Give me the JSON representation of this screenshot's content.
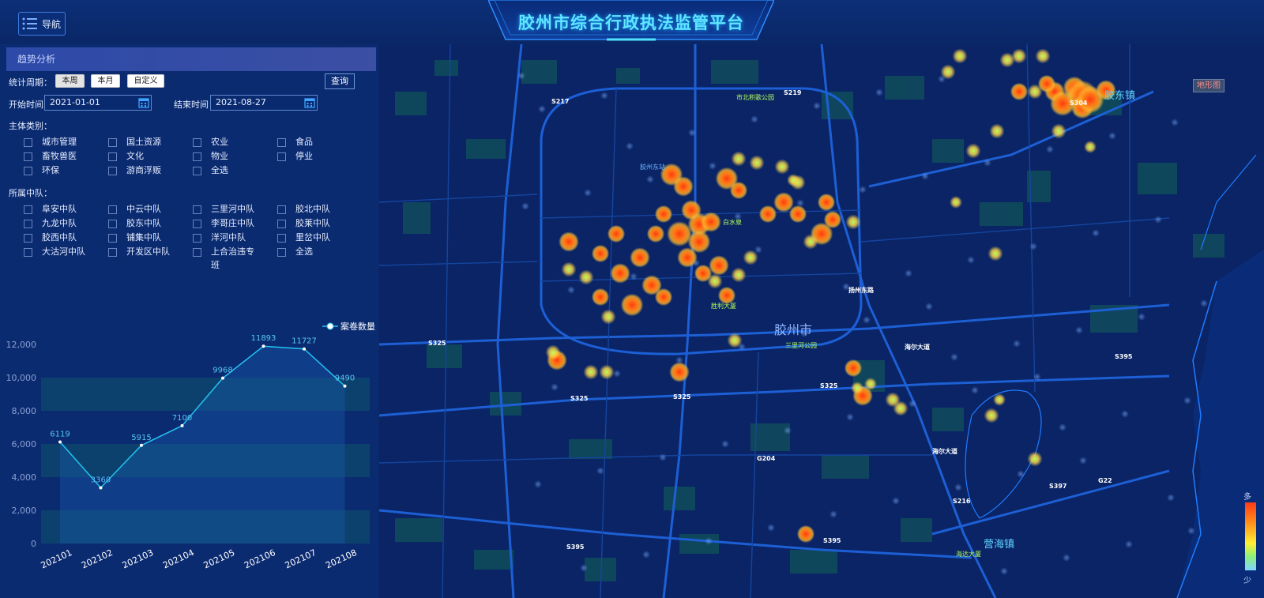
{
  "header": {
    "nav_label": "导航",
    "title": "胶州市综合行政执法监管平台"
  },
  "panel": {
    "title": "趋势分析",
    "period_label": "统计周期：",
    "period_buttons": [
      "本周",
      "本月",
      "自定义"
    ],
    "query_label": "查询",
    "start_label": "开始时间",
    "start_value": "2021-01-01",
    "end_label": "结束时间",
    "end_value": "2021-08-27",
    "subject_label": "主体类别：",
    "subjects": [
      "城市管理",
      "国土资源",
      "农业",
      "食品",
      "畜牧兽医",
      "文化",
      "物业",
      "停业",
      "环保",
      "游商浮贩",
      "全选"
    ],
    "team_label": "所属中队：",
    "teams": [
      "阜安中队",
      "中云中队",
      "三里河中队",
      "胶北中队",
      "九龙中队",
      "胶东中队",
      "李哥庄中队",
      "胶莱中队",
      "胶西中队",
      "铺集中队",
      "洋河中队",
      "里岔中队",
      "大沽河中队",
      "开发区中队",
      "上合治违专班",
      "全选"
    ]
  },
  "chart_data": {
    "type": "line",
    "categories": [
      "202101",
      "202102",
      "202103",
      "202104",
      "202105",
      "202106",
      "202107",
      "202108"
    ],
    "series": [
      {
        "name": "案卷数量",
        "values": [
          6119,
          3360,
          5915,
          7100,
          9968,
          11893,
          11727,
          9490
        ]
      }
    ],
    "y_ticks": [
      "0",
      "2,000",
      "4,000",
      "6,000",
      "8,000",
      "10,000",
      "12,000"
    ],
    "ylim": [
      0,
      12000
    ],
    "legend_position": "top-right",
    "title": "",
    "xlabel": "",
    "ylabel": "",
    "colors": {
      "line": "#22c4f0",
      "area": "#1a5fb5"
    }
  },
  "map": {
    "terrain_label": "地形图",
    "legend_top": "多",
    "legend_bottom": "少",
    "city_label": "胶州市",
    "town_east": "胶东镇",
    "town_south": "营海镇",
    "roads": [
      "S217",
      "S219",
      "S325",
      "S325",
      "S325",
      "S325",
      "S395",
      "S395",
      "S395",
      "S397",
      "G22",
      "G204",
      "S216",
      "S304"
    ],
    "road_names": [
      "扬州东路",
      "海尔大道",
      "海尔大道"
    ],
    "pois": [
      "市北积歌公园",
      "三里河公园",
      "胜利大厦",
      "白水泉",
      "海达大厦",
      "胶州东站"
    ]
  }
}
